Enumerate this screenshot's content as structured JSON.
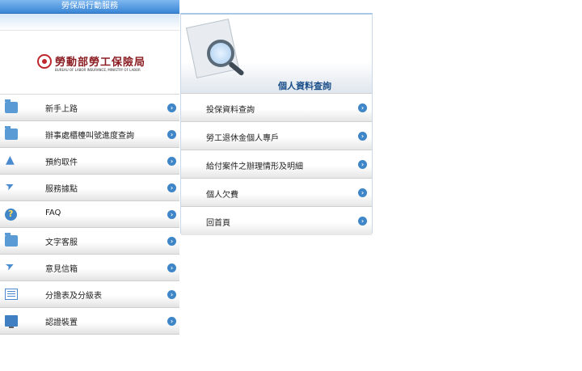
{
  "header_bar": {
    "title": "勞保局行動服務"
  },
  "logo": {
    "name": "勞動部勞工保險局",
    "english": "BUREAU OF LABOR INSURANCE, MINISTRY OF LABOR"
  },
  "menu": [
    {
      "label": "新手上路",
      "icon": "folder-icon"
    },
    {
      "label": "辦事處櫃檯叫號進度查詢",
      "icon": "folder-icon"
    },
    {
      "label": "預約取件",
      "icon": "bell-icon"
    },
    {
      "label": "服務據點",
      "icon": "send-icon"
    },
    {
      "label": "FAQ",
      "icon": "help-icon"
    },
    {
      "label": "文字客服",
      "icon": "folder-icon"
    },
    {
      "label": "意見信箱",
      "icon": "send-icon"
    },
    {
      "label": "分擔表及分級表",
      "icon": "table-icon"
    },
    {
      "label": "認證裝置",
      "icon": "monitor-icon"
    }
  ],
  "panel": {
    "title": "個人資料查詢",
    "items": [
      {
        "label": "投保資料查詢"
      },
      {
        "label": "勞工退休金個人專戶"
      },
      {
        "label": "給付案件之辦理情形及明細"
      },
      {
        "label": "個人欠費"
      },
      {
        "label": "回首頁"
      }
    ]
  }
}
